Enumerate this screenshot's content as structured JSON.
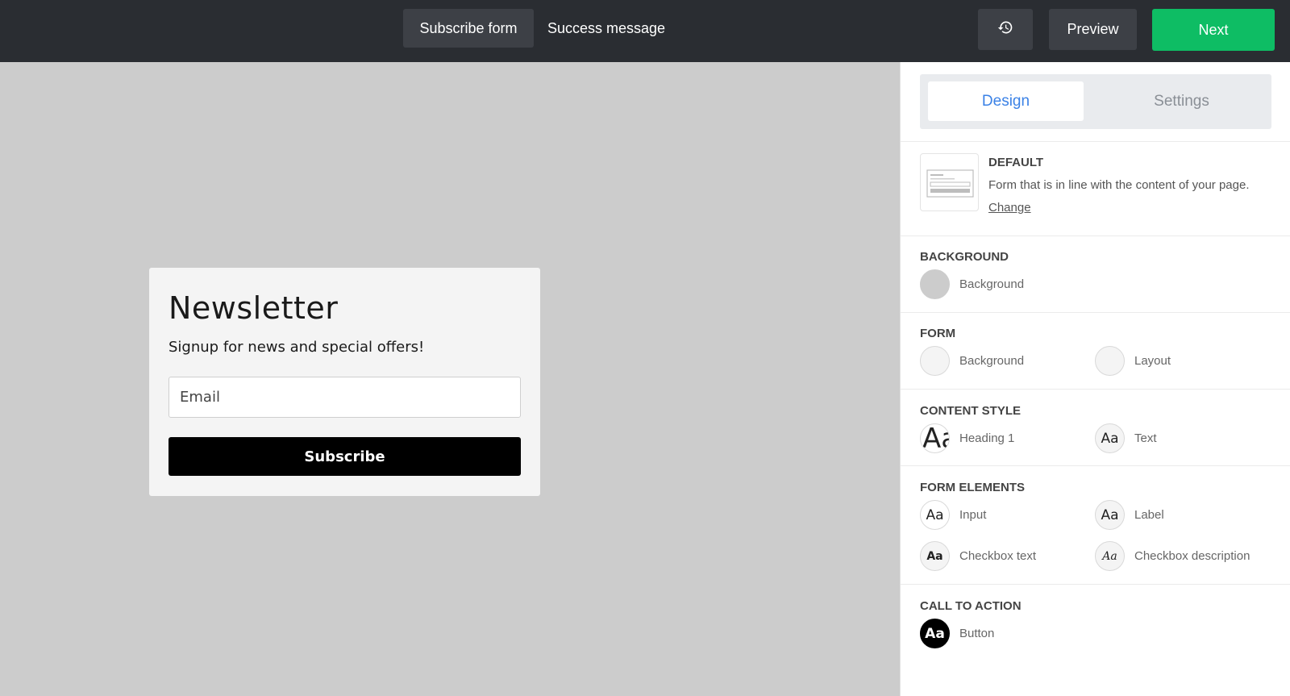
{
  "topbar": {
    "tabs": [
      "Subscribe form",
      "Success message"
    ],
    "history_icon": "history-icon",
    "preview_label": "Preview",
    "next_label": "Next",
    "next_color": "#0ebd64"
  },
  "form": {
    "heading": "Newsletter",
    "subheading": "Signup for news and special offers!",
    "email_placeholder": "Email",
    "button_label": "Subscribe"
  },
  "panel": {
    "tabs": {
      "design": "Design",
      "settings": "Settings"
    },
    "template": {
      "title": "DEFAULT",
      "description": "Form that is in line with the content of your page.",
      "change_label": "Change"
    },
    "sections": {
      "background": {
        "title": "BACKGROUND",
        "options": [
          "Background"
        ]
      },
      "form": {
        "title": "FORM",
        "options": [
          "Background",
          "Layout"
        ]
      },
      "content_style": {
        "title": "CONTENT STYLE",
        "options": [
          "Heading 1",
          "Text"
        ]
      },
      "form_elements": {
        "title": "FORM ELEMENTS",
        "options": [
          "Input",
          "Label",
          "Checkbox text",
          "Checkbox description"
        ]
      },
      "call_to_action": {
        "title": "CALL TO ACTION",
        "options": [
          "Button"
        ]
      }
    },
    "swatch_glyph": "Aa",
    "accent_color": "#3b82e6"
  }
}
